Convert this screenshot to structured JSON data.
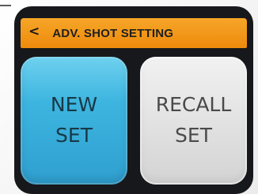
{
  "header": {
    "back_glyph": "<",
    "title": "ADV. SHOT SETTING"
  },
  "buttons": {
    "new_set": {
      "line1": "NEW",
      "line2": "SET"
    },
    "recall_set": {
      "line1": "RECALL",
      "line2": "SET"
    }
  },
  "colors": {
    "header": "#F29A1A",
    "new_set_button": "#3DB5E0",
    "recall_set_button": "#E2E2E2",
    "device_bezel": "#17181B"
  },
  "icons": {
    "back": "chevron-left-icon"
  }
}
